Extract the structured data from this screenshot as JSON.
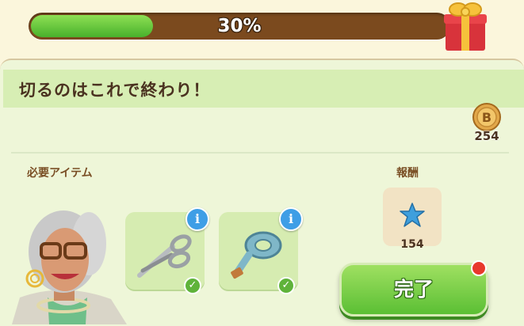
{
  "progress": {
    "text": "30%",
    "fraction": 0.3
  },
  "panel": {
    "title": "切るのはこれで終わり！",
    "coin_count": "254",
    "required_label": "必要アイテム",
    "reward_label": "報酬",
    "reward_count": "154",
    "complete_button": "完了"
  },
  "items": [
    {
      "icon": "scissors-icon",
      "info": "i",
      "check": "✓"
    },
    {
      "icon": "measuring-tape-icon",
      "info": "i",
      "check": "✓"
    }
  ],
  "colors": {
    "accent_green": "#5bbf34",
    "progress_track": "#7b4a1e",
    "info_blue": "#3e9ee6",
    "notification_red": "#e8382c"
  }
}
